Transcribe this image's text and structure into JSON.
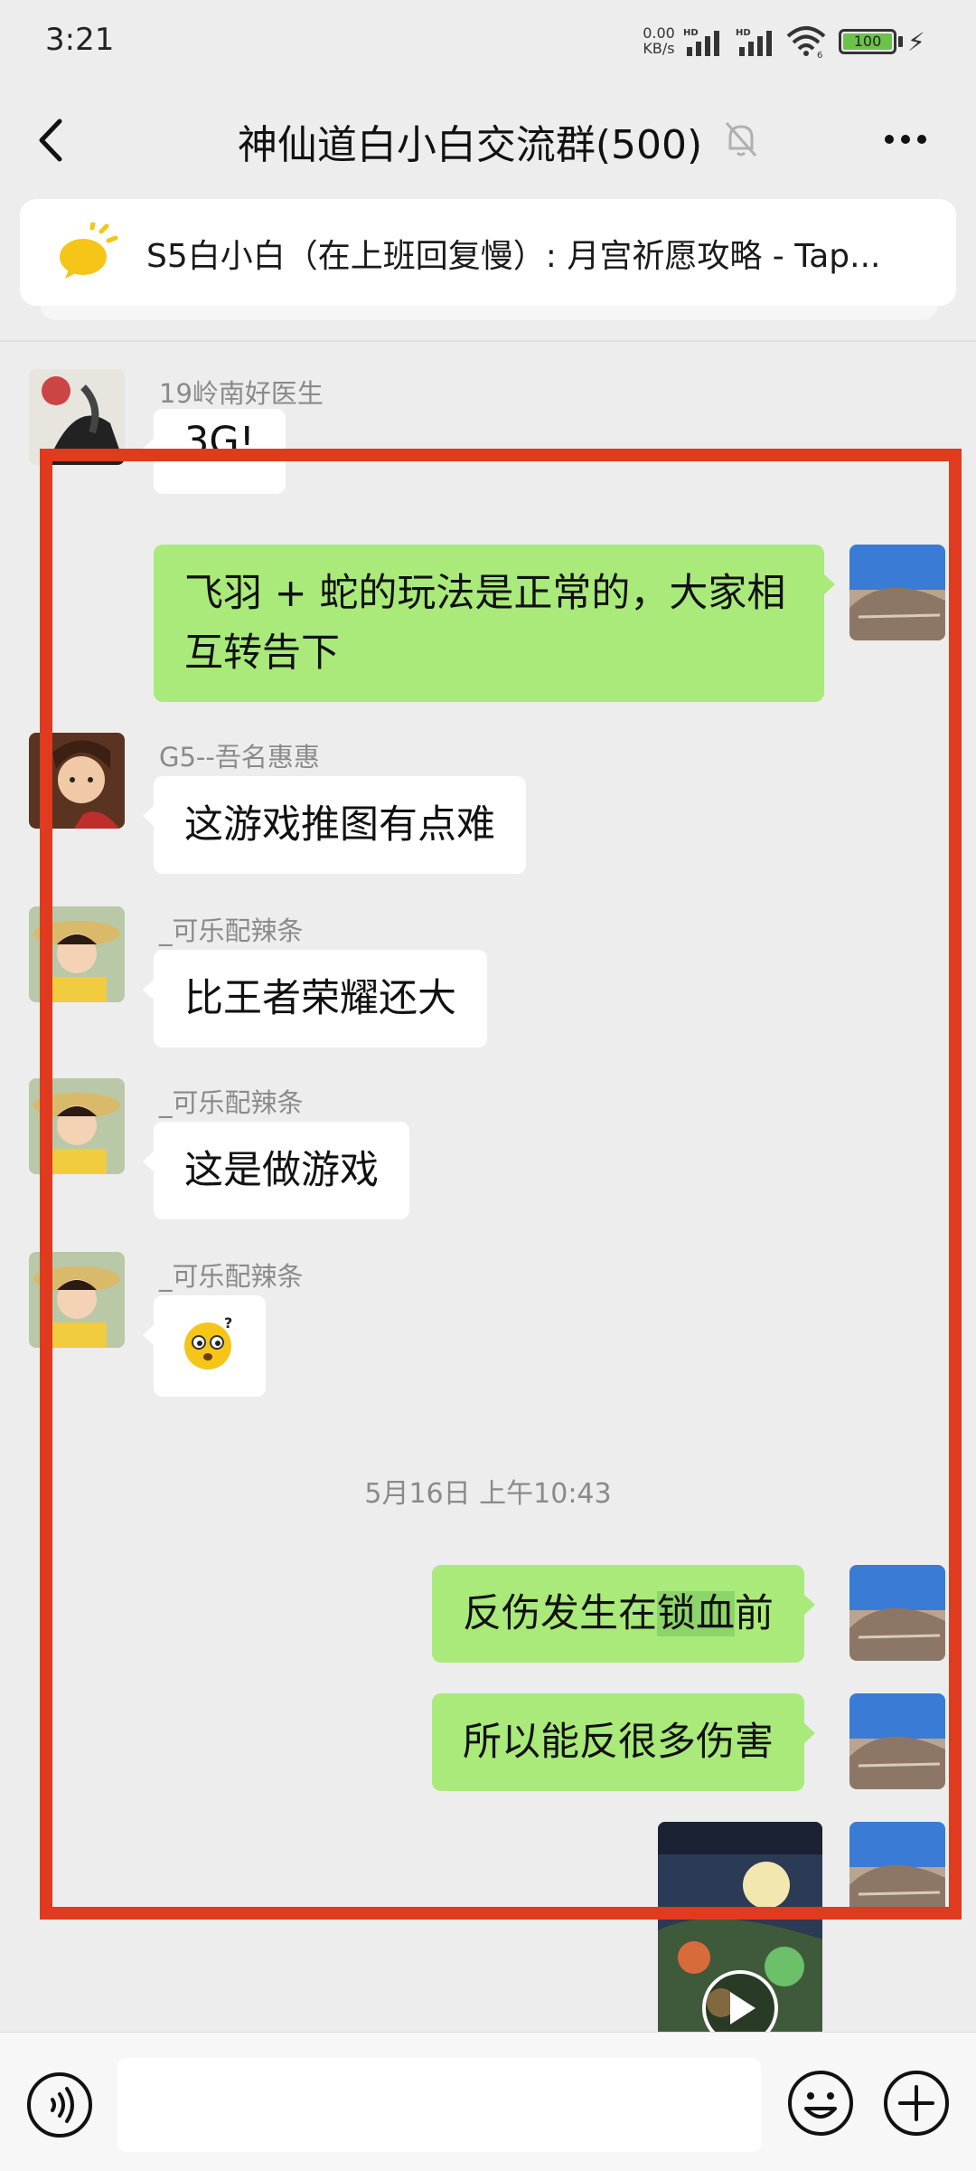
{
  "status_bar": {
    "time": "3:21",
    "network_speed_value": "0.00",
    "network_speed_unit": "KB/s",
    "signal1_label": "HD",
    "signal2_label": "HD",
    "wifi_label": "6",
    "battery": "100"
  },
  "header": {
    "title": "神仙道白小白交流群(500)",
    "back_icon": "chevron-left-icon",
    "mute_icon": "bell-muted-icon",
    "more_icon": "more-dots-icon"
  },
  "pinned_notice": {
    "icon": "announcement-icon",
    "text": "S5白小白（在上班回复慢）: 月宫祈愿攻略 - Tap..."
  },
  "messages": [
    {
      "sender": "19岭南好医生",
      "text": "3G!"
    },
    {
      "text": "飞羽 + 蛇的玩法是正常的，大家相互转告下"
    },
    {
      "sender": "G5--吾名惠惠",
      "text": "这游戏推图有点难"
    },
    {
      "sender": "_可乐配辣条",
      "text": "比王者荣耀还大"
    },
    {
      "sender": "_可乐配辣条",
      "text": "这是做游戏"
    },
    {
      "sender": "_可乐配辣条",
      "sticker": "confused-emoji"
    },
    {
      "timestamp": "5月16日 上午10:43"
    },
    {
      "text_before": "反伤发生在",
      "text_highlight": "锁血",
      "text_after": "前"
    },
    {
      "text": "所以能反很多伤害"
    },
    {
      "video": "game-video-thumbnail"
    }
  ],
  "input_bar": {
    "voice_icon": "voice-icon",
    "placeholder": "",
    "emoji_icon": "emoji-icon",
    "plus_icon": "plus-icon"
  },
  "colors": {
    "chat_background": "#ededed",
    "outgoing_bubble": "#a9ea7a",
    "incoming_bubble": "#ffffff",
    "annotation_border": "#e03a1f"
  }
}
